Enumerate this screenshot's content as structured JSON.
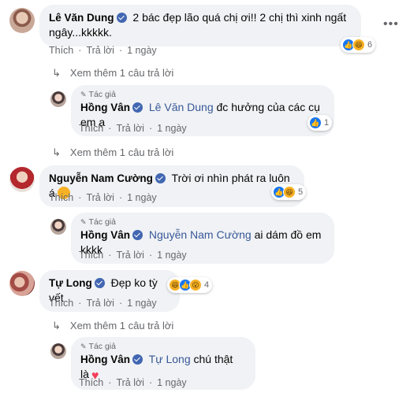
{
  "comments": [
    {
      "name": "Lê Văn Dung",
      "text": "2 bác đẹp lão quá chị ơi!! 2 chị thì xinh ngất ngây...kkkkk.",
      "actions": {
        "like": "Thích",
        "reply": "Trả lời",
        "time": "1 ngày"
      },
      "reaction_count": "6",
      "more_replies": "Xem thêm 1 câu trả lời",
      "reply": {
        "author_tag": "Tác giả",
        "name": "Hồng Vân",
        "mention": "Lê Văn Dung",
        "text": "đc hưởng của các cụ em ạ",
        "actions": {
          "like": "Thích",
          "reply": "Trả lời",
          "time": "1 ngày"
        },
        "reaction_count": "1"
      },
      "more_replies_after": "Xem thêm 1 câu trả lời"
    },
    {
      "name": "Nguyễn Nam Cường",
      "text": "Trời ơi nhìn phát ra luôn á",
      "actions": {
        "like": "Thích",
        "reply": "Trả lời",
        "time": "1 ngày"
      },
      "reaction_count": "5",
      "reply": {
        "author_tag": "Tác giả",
        "name": "Hồng Vân",
        "mention": "Nguyễn Nam Cường",
        "text": "ai dám đồ em kkkk",
        "actions": {
          "like": "Thích",
          "reply": "Trả lời",
          "time": "1 ngày"
        }
      }
    },
    {
      "name": "Tự Long",
      "text": "Đẹp ko tỳ vết",
      "actions": {
        "like": "Thích",
        "reply": "Trả lời",
        "time": "1 ngày"
      },
      "reaction_count": "4",
      "more_replies": "Xem thêm 1 câu trả lời",
      "reply": {
        "author_tag": "Tác giả",
        "name": "Hồng Vân",
        "mention": "Tự Long",
        "text": "chú thật là",
        "actions": {
          "like": "Thích",
          "reply": "Trả lời",
          "time": "1 ngày"
        }
      }
    }
  ],
  "icons": {
    "verified": "verified-badge-icon",
    "more": "more-options-icon",
    "reply_arrow": "reply-arrow-icon",
    "like": "like-reaction-icon",
    "haha": "haha-reaction-icon",
    "wow": "wow-reaction-icon",
    "heart": "heart-icon",
    "love_face": "love-face-emoji-icon"
  },
  "colors": {
    "link": "#385898",
    "bubble": "#f0f2f5",
    "muted": "#65676b",
    "like": "#1877f2"
  }
}
